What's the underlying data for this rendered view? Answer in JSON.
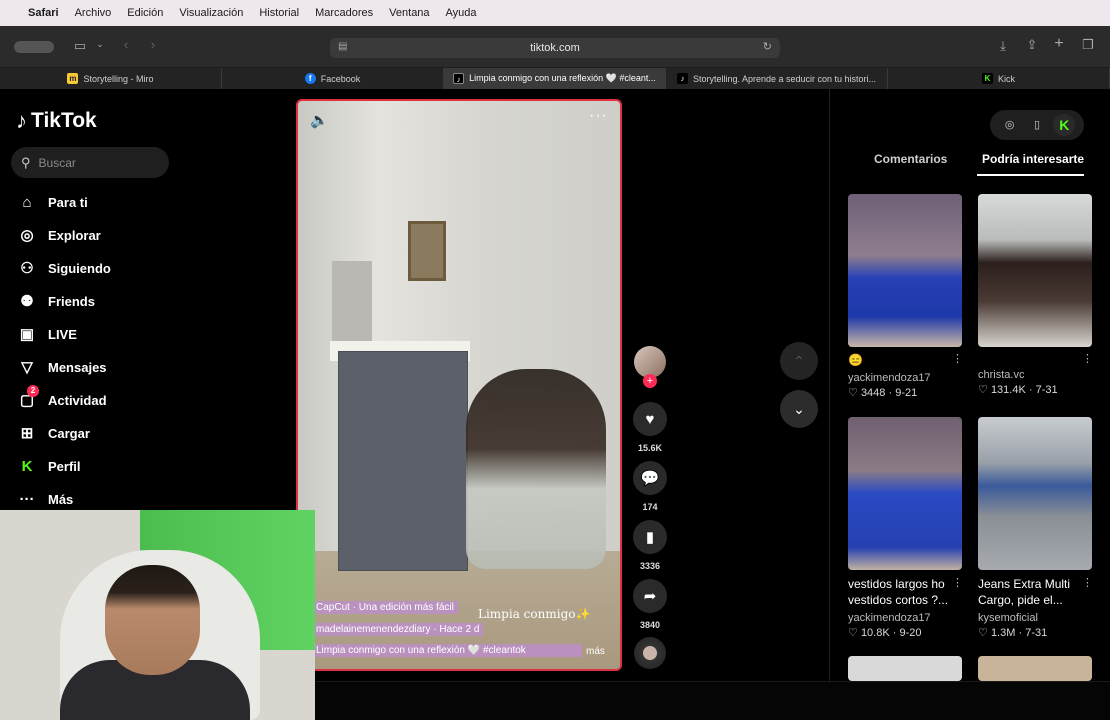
{
  "menubar": {
    "apple": "",
    "items": [
      "Safari",
      "Archivo",
      "Edición",
      "Visualización",
      "Historial",
      "Marcadores",
      "Ventana",
      "Ayuda"
    ]
  },
  "browser": {
    "url": "tiktok.com",
    "tabs": [
      {
        "label": "Storytelling - Miro",
        "favicon": "miro-icon",
        "fav_char": "m",
        "fav_color": "#f7c936"
      },
      {
        "label": "Facebook",
        "favicon": "facebook-icon",
        "fav_char": "f",
        "fav_color": "#1877f2"
      },
      {
        "label": "Limpia conmigo con una reflexión 🤍 #cleant...",
        "favicon": "tiktok-icon",
        "fav_char": "♪",
        "fav_color": "#000000"
      },
      {
        "label": "Storytelling. Aprende a seducir con tu histori...",
        "favicon": "tiktok-icon",
        "fav_char": "♪",
        "fav_color": "#000000"
      },
      {
        "label": "Kick",
        "favicon": "kick-icon",
        "fav_char": "K",
        "fav_color": "#53fc18"
      }
    ]
  },
  "sidebar": {
    "logo": "TikTok",
    "search_placeholder": "Buscar",
    "items": [
      {
        "label": "Para ti",
        "icon": "home-icon"
      },
      {
        "label": "Explorar",
        "icon": "compass-icon"
      },
      {
        "label": "Siguiendo",
        "icon": "following-icon"
      },
      {
        "label": "Friends",
        "icon": "friends-icon"
      },
      {
        "label": "LIVE",
        "icon": "live-icon"
      },
      {
        "label": "Mensajes",
        "icon": "messages-icon"
      },
      {
        "label": "Actividad",
        "icon": "activity-icon",
        "badge": "2"
      },
      {
        "label": "Cargar",
        "icon": "upload-icon"
      },
      {
        "label": "Perfil",
        "icon": "profile-icon"
      },
      {
        "label": "Más",
        "icon": "more-icon"
      }
    ]
  },
  "video": {
    "capcut": "CapCut · Una edición más fácil",
    "overlay_text": "Limpia conmigo✨",
    "author": "madelainemenendezdiary · Hace 2 d",
    "caption": "Limpia conmigo con una reflexión 🤍 #cleantok",
    "more": "más",
    "actions": {
      "likes": "15.6K",
      "comments": "174",
      "saves": "3336",
      "shares": "3840"
    }
  },
  "panel": {
    "tabs": [
      "Comentarios",
      "Podría interesarte"
    ],
    "active_tab": 1,
    "cards": [
      {
        "title": "😑",
        "user": "yackimendoza17",
        "likes": "3448",
        "date": "9-21"
      },
      {
        "title": "",
        "user": "christa.vc",
        "likes": "131.4K",
        "date": "7-31"
      },
      {
        "title": "vestidos largos ho vestidos cortos ?...",
        "user": "yackimendoza17",
        "likes": "10.8K",
        "date": "9-20"
      },
      {
        "title": "Jeans Extra Multi Cargo, pide el...",
        "user": "kysemoficial",
        "likes": "1.3M",
        "date": "7-31"
      }
    ]
  }
}
